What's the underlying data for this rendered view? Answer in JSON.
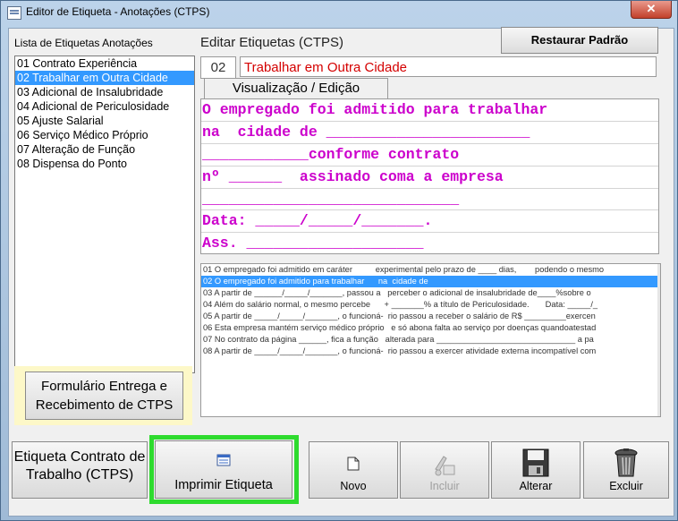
{
  "window": {
    "title": "Editor de Etiqueta - Anotações (CTPS)",
    "close_glyph": "✕"
  },
  "left": {
    "list_label": "Lista de Etiquetas Anotações",
    "items": [
      "01 Contrato Experiência",
      "02 Trabalhar em Outra Cidade",
      "03 Adicional de Insalubridade",
      "04 Adicional de Periculosidade",
      "05 Ajuste Salarial",
      "06 Serviço Médico Próprio",
      "07 Alteração de Função",
      "08 Dispensa do Ponto"
    ],
    "selected_index": 1,
    "form_button": "Formulário Entrega e Recebimento de CTPS"
  },
  "editor": {
    "title": "Editar Etiquetas (CTPS)",
    "restore_button": "Restaurar Padrão",
    "code": "02",
    "name": "Trabalhar em Outra Cidade",
    "tab_label": "Visualização / Edição",
    "lines": [
      "O empregado foi admitido para trabalhar",
      "na  cidade de _______________________",
      "____________conforme contrato",
      "nº ______  assinado coma a empresa",
      "_____________________________",
      "Data: _____/_____/_______.",
      "Ass. ____________________"
    ],
    "text_color": "#cc00cc"
  },
  "preview": {
    "lines": [
      "01 O empregado foi admitido em caráter          experimental pelo prazo de ____ dias,        podendo o mesmo",
      "02 O empregado foi admitido para trabalhar      na  cidade de",
      "03 A partir de ______/_____/_______, passou a   perceber o adicional de insalubridade de____%sobre o",
      "04 Além do salário normal, o mesmo percebe      + _______% a título de Periculosidade.       Data: _____/_",
      "05 A partir de _____/_____/_______, o funcioná-  rio passou a receber o salário de R$ _________exercen",
      "06 Esta empresa mantém serviço médico próprio   e só abona falta ao serviço por doenças quandoatestad",
      "07 No contrato da página ______, fica a função   alterada para ______________________________ a pa",
      "08 A partir de _____/_____/_______, o funcioná-  rio passou a exercer atividade externa incompatível com"
    ],
    "selected_index": 1
  },
  "toolbar": {
    "etiqueta_contrato": "Etiqueta Contrato de Trabalho (CTPS)",
    "imprimir": "Imprimir Etiqueta",
    "novo": "Novo",
    "incluir": "Incluir",
    "alterar": "Alterar",
    "excluir": "Excluir",
    "highlight_color": "#2edb2e"
  }
}
